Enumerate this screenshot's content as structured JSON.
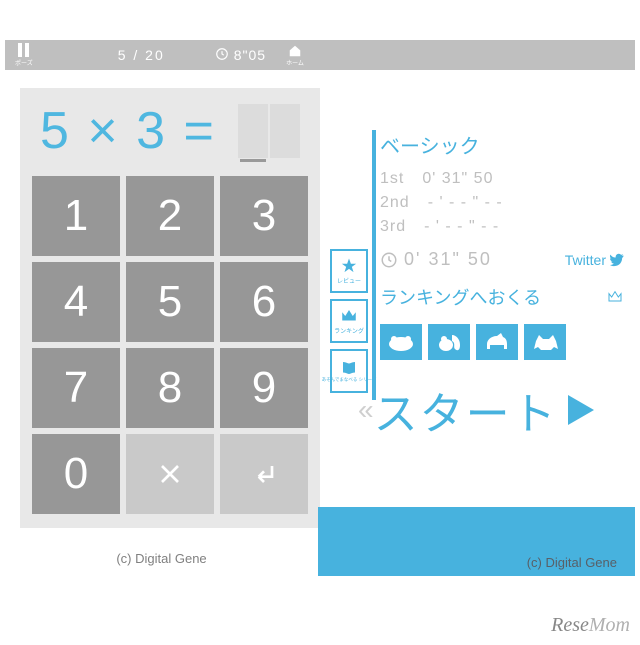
{
  "topbar": {
    "pause_label": "ポーズ",
    "progress": "5 / 20",
    "time": "8\"05",
    "home_label": "ホーム"
  },
  "equation": {
    "text": "5 × 3 ="
  },
  "keypad": {
    "k1": "1",
    "k2": "2",
    "k3": "3",
    "k4": "4",
    "k5": "5",
    "k6": "6",
    "k7": "7",
    "k8": "8",
    "k9": "9",
    "k0": "0"
  },
  "side": {
    "review": "レビュー",
    "ranking": "ランキング",
    "series": "あそんでまなべる\nシリーズ"
  },
  "right": {
    "mode": "ベーシック",
    "ranks": [
      {
        "place": "1st",
        "time": "0' 31\" 50"
      },
      {
        "place": "2nd",
        "time": "- ' - - \" - -"
      },
      {
        "place": "3rd",
        "time": "- ' - - \" - -"
      }
    ],
    "best_time": "0' 31\" 50",
    "twitter": "Twitter",
    "send_ranking": "ランキングへおくる",
    "start": "スタート"
  },
  "footer": {
    "left": "(c) Digital Gene",
    "right": "(c) Digital Gene"
  },
  "watermark": "ReseMom"
}
